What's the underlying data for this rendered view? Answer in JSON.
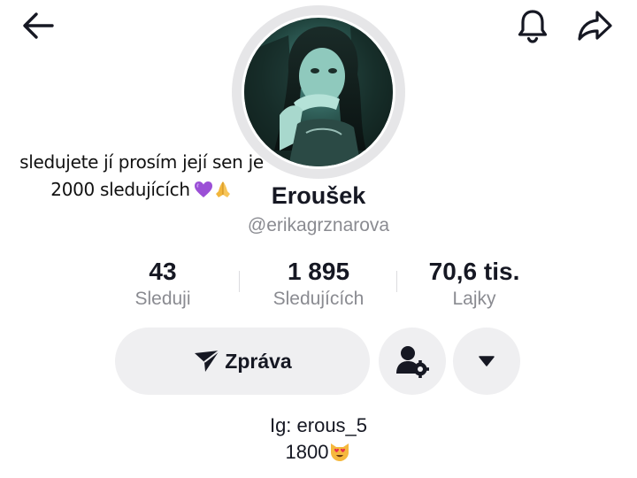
{
  "header": {
    "back_icon": "arrow-left-icon",
    "bell_icon": "bell-icon",
    "share_icon": "share-arrow-icon"
  },
  "overlay_caption": {
    "line1": "sledujete jí prosím její sen je",
    "line2": "2000 sledujících",
    "emojis": [
      "purple-heart-icon",
      "folded-hands-icon"
    ]
  },
  "profile": {
    "display_name": "Eroušek",
    "handle": "@erikagrznarova",
    "avatar": "profile-photo"
  },
  "stats": [
    {
      "value": "43",
      "label": "Sleduji"
    },
    {
      "value": "1 895",
      "label": "Sledujících"
    },
    {
      "value": "70,6 tis.",
      "label": "Lajky"
    }
  ],
  "actions": {
    "message_label": "Zpráva",
    "message_icon": "paper-plane-icon",
    "follow_settings_icon": "user-gear-icon",
    "more_icon": "caret-down-icon"
  },
  "bio": {
    "line1": "Ig: erous_5",
    "line2": "1800",
    "emoji": "heart-eyes-cat-icon"
  },
  "colors": {
    "text_primary": "#161823",
    "text_secondary": "#8a8b91",
    "button_bg": "#efeff1",
    "avatar_ring": "#e6e6e8"
  }
}
